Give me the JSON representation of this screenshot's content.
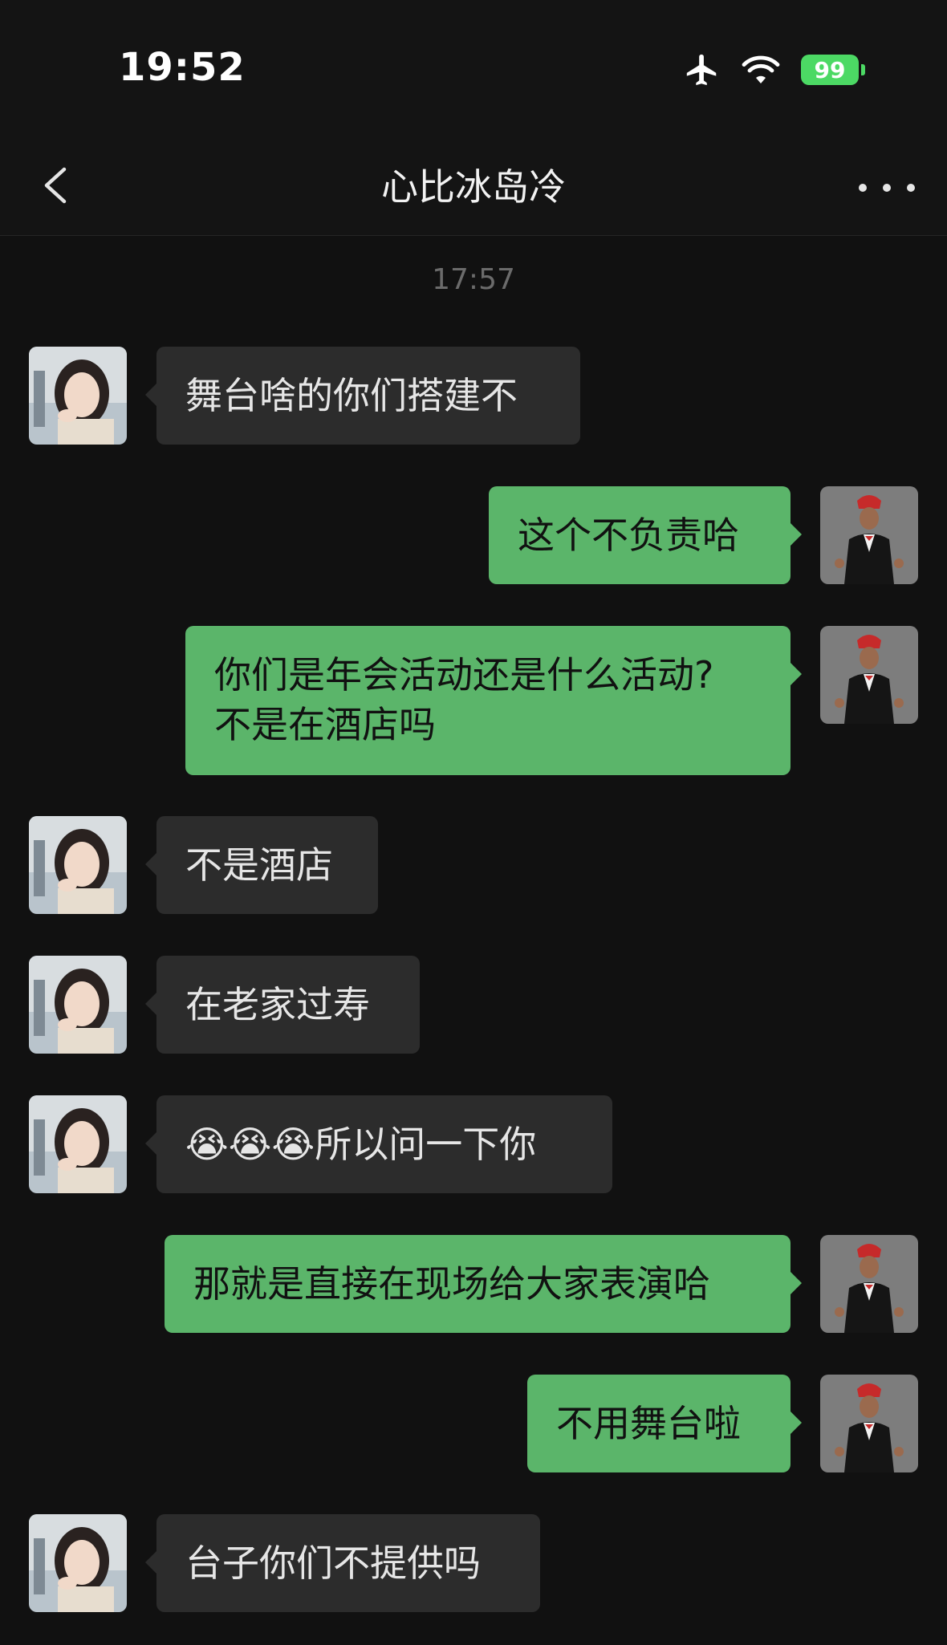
{
  "status_bar": {
    "time": "19:52",
    "battery": "99"
  },
  "nav": {
    "title": "心比冰岛冷"
  },
  "chat": {
    "timestamp": "17:57",
    "messages": [
      {
        "side": "in",
        "text": "舞台啥的你们搭建不"
      },
      {
        "side": "out",
        "text": "这个不负责哈"
      },
      {
        "side": "out",
        "text": "你们是年会活动还是什么活动?\n不是在酒店吗"
      },
      {
        "side": "in",
        "text": "不是酒店"
      },
      {
        "side": "in",
        "text": "在老家过寿"
      },
      {
        "side": "in",
        "text": "😭😭😭所以问一下你"
      },
      {
        "side": "out",
        "text": "那就是直接在现场给大家表演哈"
      },
      {
        "side": "out",
        "text": "不用舞台啦"
      },
      {
        "side": "in",
        "text": "台子你们不提供吗"
      }
    ]
  },
  "colors": {
    "incoming_bubble": "#2c2c2c",
    "outgoing_bubble": "#5bb56a",
    "background": "#111111"
  }
}
